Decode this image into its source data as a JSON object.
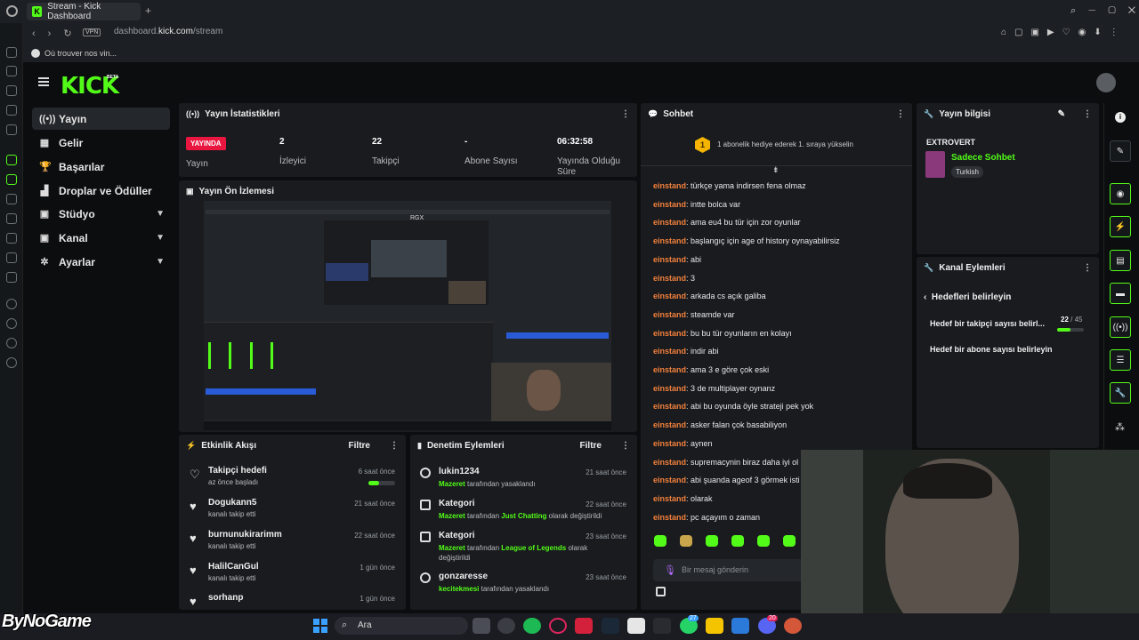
{
  "browser": {
    "tab_title": "Stream - Kick Dashboard",
    "tab_add": "+",
    "url_prefix": "dashboard.",
    "url_host": "kick.com",
    "url_path": "/stream",
    "vpn": "VPN",
    "bookmark": "Où trouver nos vin..."
  },
  "brand": {
    "logo": "KICK",
    "beta": "BETA"
  },
  "nav": [
    {
      "label": "Yayın",
      "icon": "((•))",
      "active": true
    },
    {
      "label": "Gelir",
      "icon": "▦"
    },
    {
      "label": "Başarılar",
      "icon": "🏆"
    },
    {
      "label": "Droplar ve Ödüller",
      "icon": "▟"
    },
    {
      "label": "Stüdyo",
      "icon": "▣",
      "chevron": true
    },
    {
      "label": "Kanal",
      "icon": "▣",
      "chevron": true
    },
    {
      "label": "Ayarlar",
      "icon": "✲",
      "chevron": true
    }
  ],
  "stats": {
    "title": "Yayın İstatistikleri",
    "status_badge": "YAYINDA",
    "status_label": "Yayın",
    "viewers_value": "2",
    "viewers_label": "İzleyici",
    "followers_value": "22",
    "followers_label": "Takipçi",
    "subs_value": "-",
    "subs_label": "Abone Sayısı",
    "uptime_value": "06:32:58",
    "uptime_label": "Yayında Olduğu Süre"
  },
  "preview": {
    "title": "Yayın Ön İzlemesi",
    "overlay_text": "RGX"
  },
  "activity": {
    "title": "Etkinlik Akışı",
    "filter": "Filtre",
    "items": [
      {
        "title": "Takipçi hedefi",
        "sub": "az önce başladı",
        "time": "6 saat önce",
        "progress": 0.4
      },
      {
        "title": "Dogukann5",
        "sub": "kanalı takip etti",
        "time": "21 saat önce"
      },
      {
        "title": "burnunukirarimm",
        "sub": "kanalı takip etti",
        "time": "22 saat önce"
      },
      {
        "title": "HalilCanGul",
        "sub": "kanalı takip etti",
        "time": "1 gün önce"
      },
      {
        "title": "sorhanp",
        "sub": "",
        "time": "1 gün önce"
      }
    ]
  },
  "moderation": {
    "title": "Denetim Eylemleri",
    "filter": "Filtre",
    "items": [
      {
        "title": "lukin1234",
        "actor": "Mazeret",
        "middle": "tarafından yasaklandı",
        "target": "",
        "end": "",
        "time": "21 saat önce"
      },
      {
        "title": "Kategori",
        "actor": "Mazeret",
        "middle": "tarafından",
        "target": "Just Chatting",
        "end": "olarak değiştirildi",
        "time": "22 saat önce"
      },
      {
        "title": "Kategori",
        "actor": "Mazeret",
        "middle": "tarafından",
        "target": "League of Legends",
        "end": "olarak değiştirildi",
        "time": "23 saat önce"
      },
      {
        "title": "gonzaresse",
        "actor": "kecitekmesi",
        "middle": "tarafından yasaklandı",
        "target": "",
        "end": "",
        "time": "23 saat önce"
      }
    ]
  },
  "chat": {
    "title": "Sohbet",
    "promo_number": "1",
    "promo_text": "1 abonelik hediye ederek 1. sıraya yükselin",
    "input_placeholder": "Bir mesaj gönderin",
    "messages": [
      {
        "user": "einstand",
        "text": "türkçe yama indirsen fena olmaz"
      },
      {
        "user": "einstand",
        "text": "intte bolca var"
      },
      {
        "user": "einstand",
        "text": "ama eu4 bu tür için zor oyunlar"
      },
      {
        "user": "einstand",
        "text": "başlangıç için age of history oynayabilirsiz"
      },
      {
        "user": "einstand",
        "text": "abi"
      },
      {
        "user": "einstand",
        "text": "3"
      },
      {
        "user": "einstand",
        "text": "arkada cs açık galiba"
      },
      {
        "user": "einstand",
        "text": "steamde var"
      },
      {
        "user": "einstand",
        "text": "bu bu tür oyunların en kolayı"
      },
      {
        "user": "einstand",
        "text": "indir abi"
      },
      {
        "user": "einstand",
        "text": "ama 3 e göre çok eski"
      },
      {
        "user": "einstand",
        "text": "3 de multiplayer oynanz"
      },
      {
        "user": "einstand",
        "text": "abi bu oyunda öyle strateji pek yok"
      },
      {
        "user": "einstand",
        "text": "asker falan çok basabiliyon"
      },
      {
        "user": "einstand",
        "text": "aynen"
      },
      {
        "user": "einstand",
        "text": "supremacynin biraz daha iyi ol"
      },
      {
        "user": "einstand",
        "text": "abi şuanda ageof 3 görmek isti"
      },
      {
        "user": "einstand",
        "text": "olarak"
      },
      {
        "user": "einstand",
        "text": "pc açayım o zaman"
      }
    ]
  },
  "stream_info": {
    "title": "Yayın bilgisi",
    "stream_title": "EXTROVERT",
    "category": "Sadece Sohbet",
    "language": "Turkish"
  },
  "channel_actions": {
    "title": "Kanal Eylemleri",
    "back_label": "Hedefleri belirleyin",
    "follower_goal": "Hedef bir takipçi sayısı belirl...",
    "follower_current": "22",
    "follower_target": "/ 45",
    "follower_progress": 0.49,
    "sub_goal": "Hedef bir abone sayısı belirleyin"
  },
  "taskbar": {
    "search": "Ara",
    "badge1": "27",
    "badge2": "20"
  },
  "watermark": "ByNoGame",
  "colors": {
    "accent": "#53fc18",
    "live": "#e91640",
    "username": "#f2803c",
    "panel": "#191b1f"
  }
}
